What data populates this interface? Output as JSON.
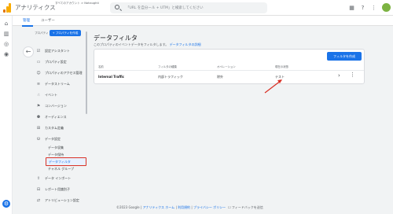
{
  "app": {
    "title": "アナリティクス"
  },
  "account": {
    "line1": "すべてのアカウント > Nahaughti",
    "line2": ""
  },
  "search": {
    "placeholder": "「URL を自分ール + UTM」と検索してください"
  },
  "admin_tabs": [
    {
      "label": "管理"
    },
    {
      "label": "ユーザー"
    }
  ],
  "property": {
    "label": "プロパティ",
    "create_button": "+ プロパティを作成"
  },
  "nav": {
    "items": [
      {
        "label": "設定アシスタント",
        "icon": "checklist-icon"
      },
      {
        "label": "プロパティ設定",
        "icon": "property-icon"
      },
      {
        "label": "プロパティのアクセス管理",
        "icon": "people-icon"
      },
      {
        "label": "データストリーム",
        "icon": "streams-icon"
      },
      {
        "label": "イベント",
        "icon": "event-icon"
      },
      {
        "label": "コンバージョン",
        "icon": "flag-icon"
      },
      {
        "label": "オーディエンス",
        "icon": "audience-icon"
      },
      {
        "label": "カスタム定義",
        "icon": "custom-icon"
      },
      {
        "label": "データ設定",
        "icon": "database-icon"
      }
    ],
    "sub_items": [
      {
        "label": "データ収集"
      },
      {
        "label": "データ保持"
      },
      {
        "label": "データフィルタ"
      },
      {
        "label": "チャネル グループ"
      }
    ],
    "bottom_items": [
      {
        "label": "データ インポート",
        "icon": "upload-icon"
      },
      {
        "label": "レポート用識別子",
        "icon": "id-icon"
      },
      {
        "label": "アトリビューション設定",
        "icon": "attribution-icon"
      }
    ]
  },
  "content": {
    "title": "データフィルタ",
    "description": "このプロパティのイベントデータをフィルタします。",
    "link": "データフィルタの詳細",
    "create_button": "フィルタを作成",
    "columns": [
      "名前",
      "フィルタの種類",
      "オペレーション",
      "現在の状態"
    ],
    "rows": [
      {
        "name": "Internal Traffic",
        "type": "内部トラフィック",
        "operation": "除外",
        "state": "テスト"
      }
    ]
  },
  "footer": {
    "copyright": "©2023 Google",
    "home": "アナリティクス ホーム",
    "terms": "利用規約",
    "privacy": "プライバシー ポリシー",
    "feedback": "フィードバックを送信"
  },
  "colors": {
    "accent": "#1a73e8",
    "highlight": "#d93025",
    "logo": "#f9ab00"
  }
}
